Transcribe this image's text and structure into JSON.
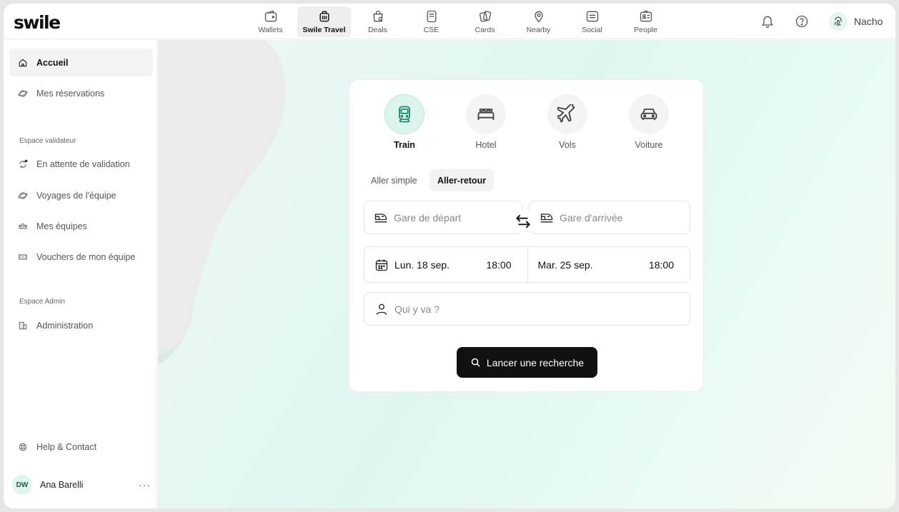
{
  "brand": {
    "logo": "swile"
  },
  "nav": [
    {
      "label": "Wallets",
      "icon": "wallet-icon",
      "active": false
    },
    {
      "label": "Swile Travel",
      "icon": "luggage-icon",
      "active": true
    },
    {
      "label": "Deals",
      "icon": "shopping-bag-icon",
      "active": false
    },
    {
      "label": "CSE",
      "icon": "cse-icon",
      "active": false
    },
    {
      "label": "Cards",
      "icon": "cards-icon",
      "active": false
    },
    {
      "label": "Nearby",
      "icon": "location-pin-icon",
      "active": false
    },
    {
      "label": "Social",
      "icon": "social-icon",
      "active": false
    },
    {
      "label": "People",
      "icon": "people-icon",
      "active": false
    }
  ],
  "header": {
    "user_name": "Nacho"
  },
  "sidebar": {
    "items": [
      {
        "label": "Accueil",
        "icon": "home-icon",
        "active": true
      },
      {
        "label": "Mes réservations",
        "icon": "globe-icon",
        "active": false
      }
    ],
    "validator_section": "Espace validateur",
    "validator_items": [
      {
        "label": "En attente de validation",
        "icon": "sync-icon"
      },
      {
        "label": "Voyages de l'équipe",
        "icon": "globe-icon"
      },
      {
        "label": "Mes équipes",
        "icon": "team-icon"
      },
      {
        "label": "Vouchers de mon équipe",
        "icon": "ticket-icon"
      }
    ],
    "admin_section": "Espace Admin",
    "admin_items": [
      {
        "label": "Administration",
        "icon": "building-icon"
      }
    ],
    "help": "Help & Contact",
    "profile": {
      "initials": "DW",
      "name": "Ana Barelli",
      "more": "···"
    }
  },
  "booking": {
    "modes": [
      {
        "label": "Train",
        "icon": "train-icon",
        "active": true
      },
      {
        "label": "Hotel",
        "icon": "bed-icon",
        "active": false
      },
      {
        "label": "Vols",
        "icon": "plane-icon",
        "active": false
      },
      {
        "label": "Voiture",
        "icon": "car-icon",
        "active": false
      }
    ],
    "trip_types": [
      {
        "label": "Aller simple",
        "active": false
      },
      {
        "label": "Aller-retour",
        "active": true
      }
    ],
    "departure_placeholder": "Gare de départ",
    "arrival_placeholder": "Gare d'arrivée",
    "outbound": {
      "date": "Lun. 18 sep.",
      "time": "18:00"
    },
    "return": {
      "date": "Mar. 25 sep.",
      "time": "18:00"
    },
    "travelers_placeholder": "Qui y va ?",
    "search_label": "Lancer une recherche"
  },
  "colors": {
    "accent": "#dcf5ec",
    "button": "#111111",
    "train_icon": "#1f8a6e"
  }
}
